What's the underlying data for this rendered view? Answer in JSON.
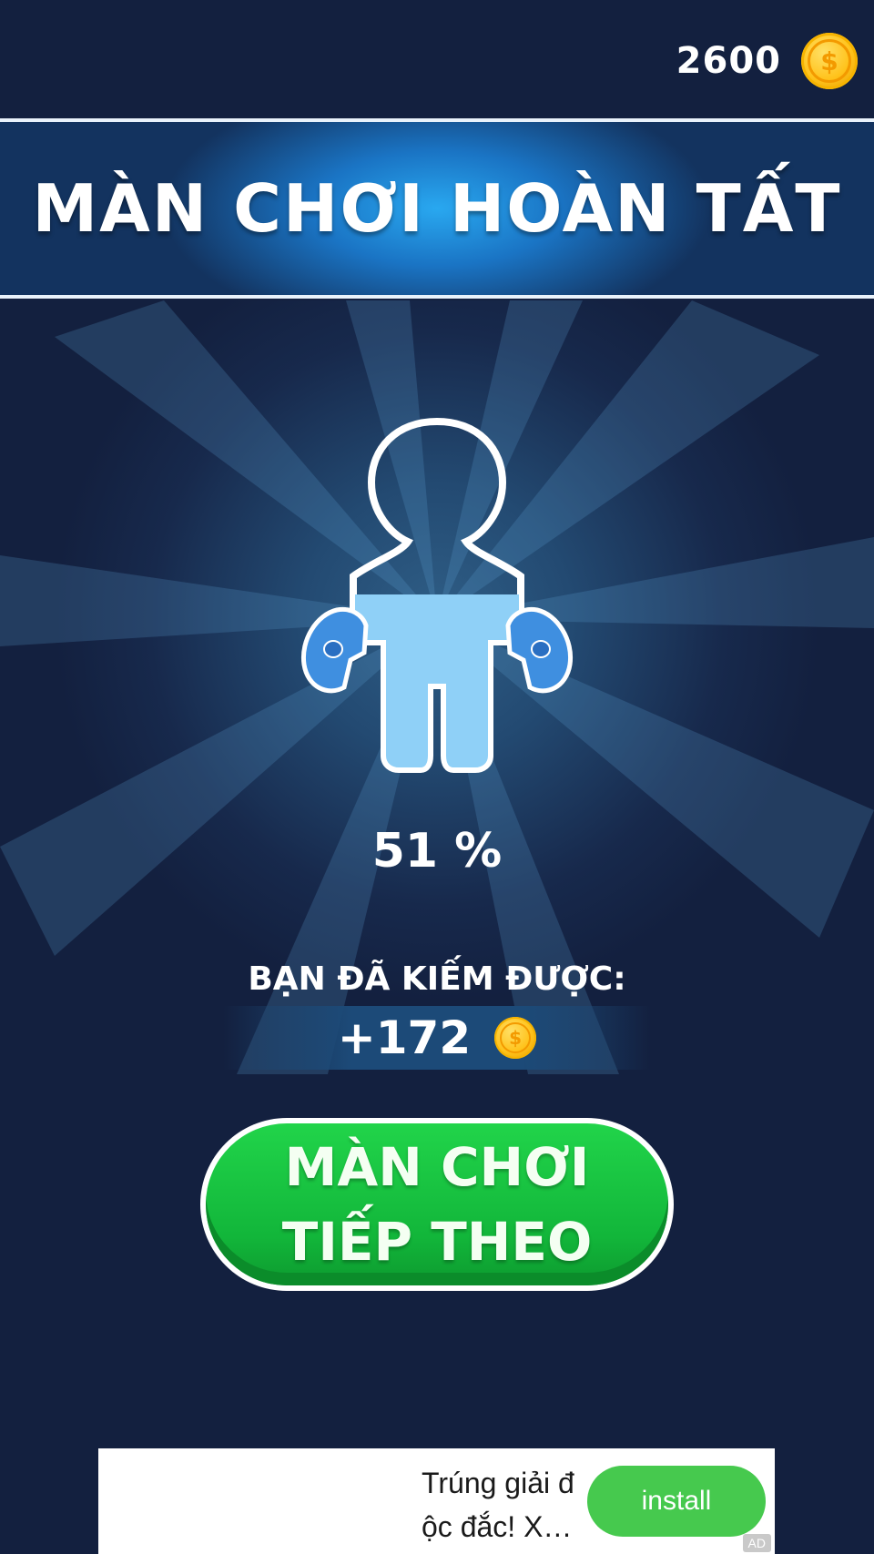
{
  "header": {
    "coins": "2600",
    "coin_icon": "coin-icon"
  },
  "banner": {
    "title": "MÀN CHƠI HOÀN TẤT"
  },
  "progress": {
    "percent_text": "51 %",
    "fill_fraction": 0.51
  },
  "reward": {
    "label": "BẠN ĐÃ KIẾM ĐƯỢC:",
    "amount": "+172"
  },
  "next_button": {
    "label": "MÀN CHƠI TIẾP THEO"
  },
  "ad": {
    "text": "Trúng giải đ ộc đắc! X…",
    "install_label": "install",
    "badge": "AD"
  },
  "colors": {
    "background": "#13203f",
    "banner": "#1a74c4",
    "button": "#12b63a",
    "figure_fill": "#8fd0f7",
    "glove": "#3f8fe0"
  }
}
